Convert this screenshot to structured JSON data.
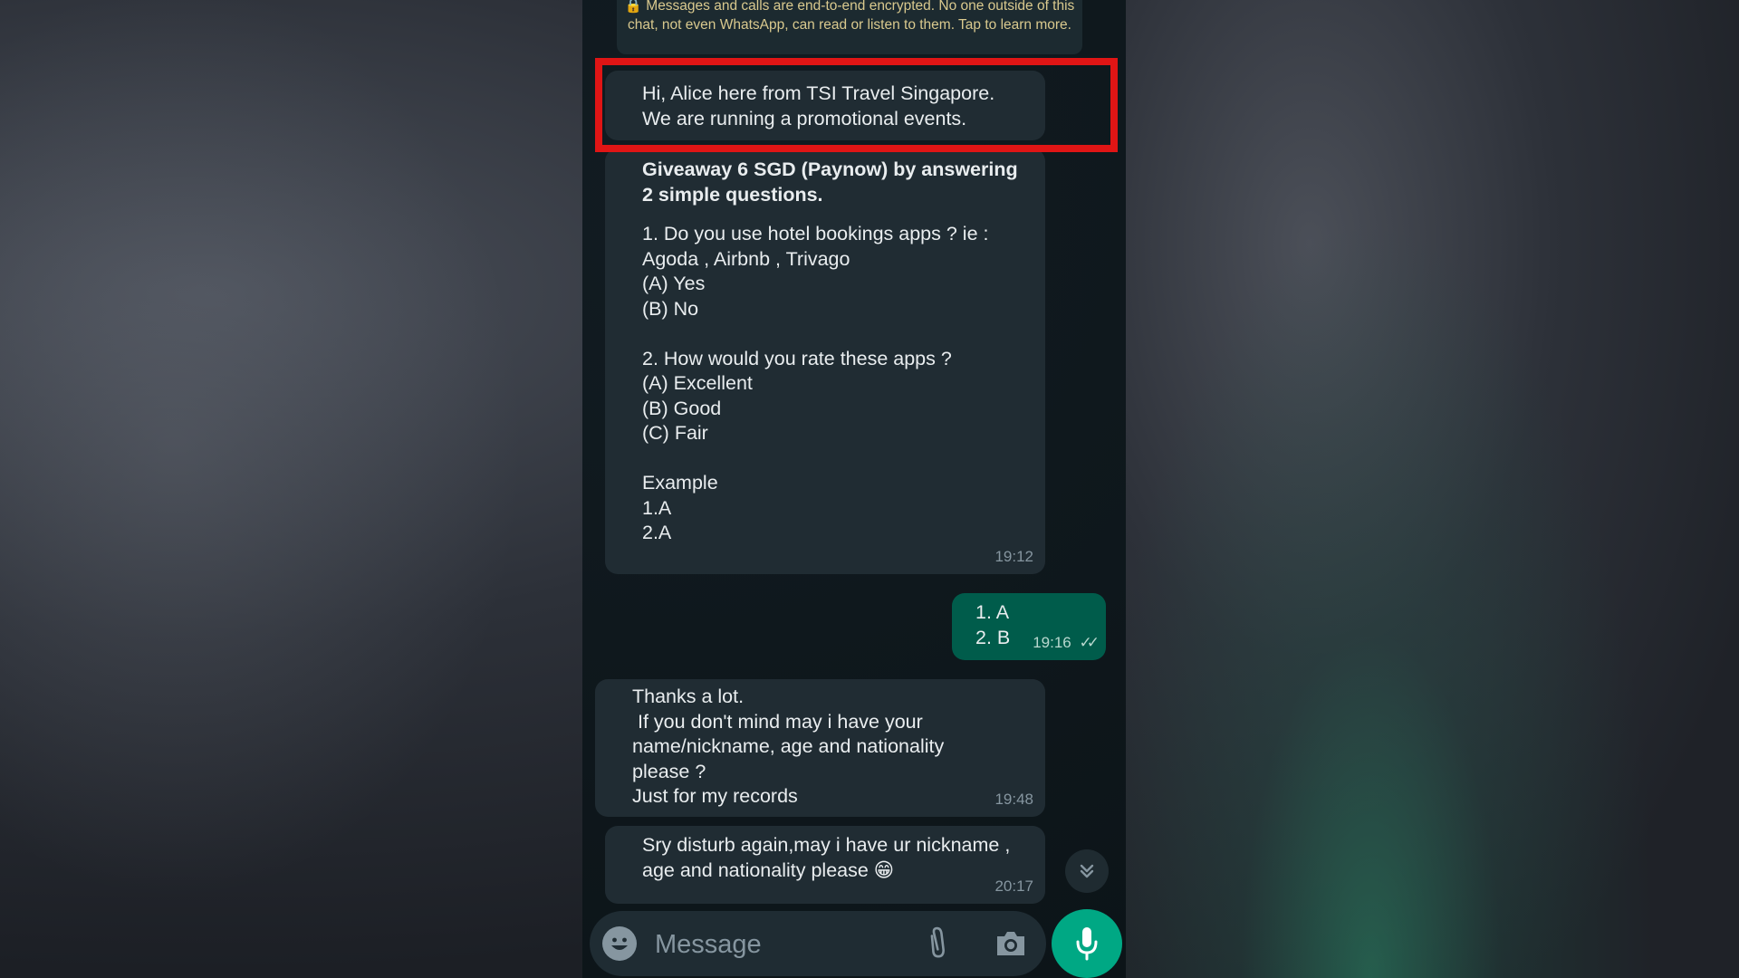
{
  "encryption_notice": "🔒 Messages and calls are end-to-end encrypted. No one outside of this chat, not even WhatsApp, can read or listen to them. Tap to learn more.",
  "messages": [
    {
      "direction": "in",
      "text": "Hi, Alice here from TSI Travel Singapore.\nWe are running a promotional events."
    },
    {
      "direction": "in",
      "bold_text": "Giveaway 6 SGD (Paynow) by answering 2 simple questions.",
      "text": "1. Do you use hotel bookings apps ? ie :\nAgoda , Airbnb , Trivago\n(A) Yes\n(B) No\n\n2. How would you rate these apps ?\n(A) Excellent\n(B) Good\n(C) Fair\n\nExample\n1.A\n2.A",
      "time": "19:12"
    },
    {
      "direction": "out",
      "text": "1. A\n2. B",
      "time": "19:16",
      "status": "read"
    },
    {
      "direction": "in",
      "text": "Thanks a lot.\n If you don't mind may i have your\nname/nickname, age and nationality\nplease ?\nJust for my records",
      "time": "19:48"
    },
    {
      "direction": "in",
      "text": "Sry disturb again,may i have ur nickname ,\nage and nationality please 😁",
      "time": "20:17"
    }
  ],
  "composer": {
    "placeholder": "Message"
  },
  "icons": {
    "emoji": "emoji-icon",
    "attach": "paperclip-icon",
    "camera": "camera-icon",
    "mic": "microphone-icon",
    "scroll_down": "double-chevron-down-icon"
  },
  "colors": {
    "incoming_bubble": "#202c33",
    "outgoing_bubble": "#005c4b",
    "accent": "#00a884",
    "highlight_box": "#e01515"
  }
}
